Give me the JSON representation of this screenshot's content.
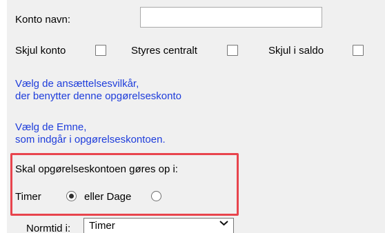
{
  "form": {
    "account_name_label": "Konto navn:",
    "account_name_value": "",
    "account_name_placeholder": "",
    "hide_account_label": "Skjul konto",
    "central_control_label": "Styres centralt",
    "hide_in_balance_label": "Skjul i saldo",
    "employment_terms_line1": "Vælg de ansættelsesvilkår,",
    "employment_terms_line2": "der benytter denne opgørelseskonto",
    "subjects_line1": "Vælg de Emne,",
    "subjects_line2": "som indgår i opgørelseskontoen.",
    "settlement_question": "Skal opgørelseskontoen gøres op i:",
    "hours_label": "Timer",
    "or_days_label": "eller Dage",
    "normal_time_label": "Normtid i:",
    "normal_time_selected": "Timer"
  },
  "states": {
    "hide_account_checked": false,
    "central_control_checked": false,
    "hide_in_balance_checked": false,
    "hours_selected": true,
    "days_selected": false
  },
  "colors": {
    "panel_background": "#f0f0f0",
    "link_blue": "#1e3ddb",
    "highlight_red": "#e8444d"
  },
  "icons": {
    "select_arrow": "chevron-down-icon"
  }
}
